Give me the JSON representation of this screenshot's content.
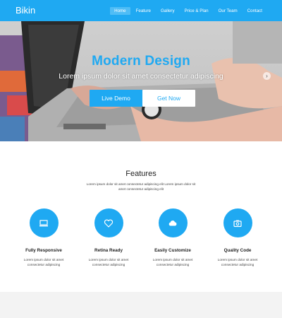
{
  "header": {
    "brand": "Bikin",
    "nav": [
      "Home",
      "Feature",
      "Gallery",
      "Price & Plan",
      "Our Team",
      "Contact"
    ]
  },
  "hero": {
    "title": "Modern Design",
    "subtitle": "Lorem ipsum dolor sit amet consectetur adipiscing",
    "primary_button": "Live Demo",
    "secondary_button": "Get Now",
    "arrow_icon": "chevron-right-icon"
  },
  "features": {
    "title": "Features",
    "description": "Lorem ipsum dolor sit amet consectetur adipiscing elit Lorem ipsum dolor sit amet consectetur adipiscing elit",
    "items": [
      {
        "title": "Fully Responsive",
        "text": "Lorem ipsum dolor sit amet consectetur adipiscing",
        "icon": "laptop-icon"
      },
      {
        "title": "Retina Ready",
        "text": "Lorem ipsum dolor sit amet consectetur adipiscing",
        "icon": "heart-icon"
      },
      {
        "title": "Easily Customize",
        "text": "Lorem ipsum dolor sit amet consectetur adipiscing",
        "icon": "cloud-icon"
      },
      {
        "title": "Quality Code",
        "text": "Lorem ipsum dolor sit amet consectetur adipiscing",
        "icon": "camera-icon"
      }
    ]
  },
  "colors": {
    "accent": "#1fa9f2",
    "nav_active": "#4fbdf6",
    "footer_band": "#f3f3f3"
  }
}
